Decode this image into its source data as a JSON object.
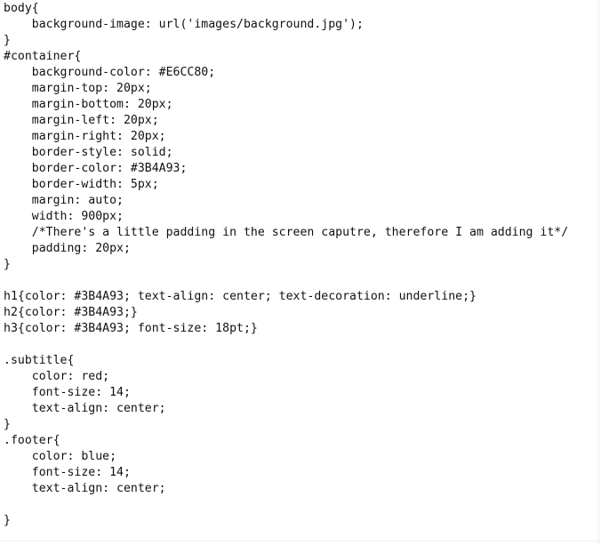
{
  "code": {
    "lines": [
      "body{",
      "    background-image: url('images/background.jpg');",
      "}",
      "#container{",
      "    background-color: #E6CC80;",
      "    margin-top: 20px;",
      "    margin-bottom: 20px;",
      "    margin-left: 20px;",
      "    margin-right: 20px;",
      "    border-style: solid;",
      "    border-color: #3B4A93;",
      "    border-width: 5px;",
      "    margin: auto;",
      "    width: 900px;",
      "    /*There's a little padding in the screen caputre, therefore I am adding it*/",
      "    padding: 20px;",
      "}",
      "",
      "h1{color: #3B4A93; text-align: center; text-decoration: underline;}",
      "h2{color: #3B4A93;}",
      "h3{color: #3B4A93; font-size: 18pt;}",
      "",
      ".subtitle{",
      "    color: red;",
      "    font-size: 14;",
      "    text-align: center;",
      "}",
      ".footer{",
      "    color: blue;",
      "    font-size: 14;",
      "    text-align: center;",
      "",
      "}"
    ]
  }
}
